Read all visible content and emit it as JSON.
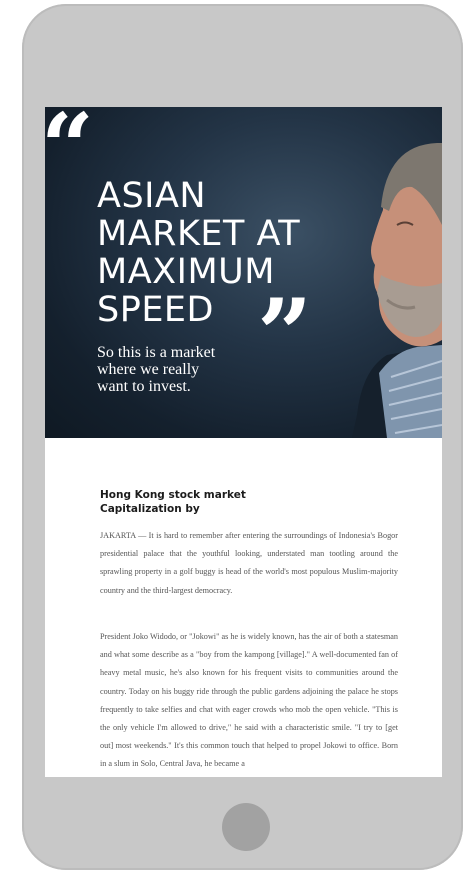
{
  "hero": {
    "headline_lines": [
      "ASIAN",
      "MARKET AT",
      "MAXIMUM",
      "SPEED"
    ],
    "subline_lines": [
      "So this is a market",
      "where we really",
      "want to invest."
    ],
    "open_quote": "“",
    "close_quote": "”"
  },
  "article": {
    "title_lines": [
      "Hong Kong stock market",
      "Capitalization by"
    ],
    "paragraph1": "JAKARTA — It is hard to remember after entering the surroundings of Indonesia's Bogor presidential palace that the youthful looking, understated man tootling around the sprawling property in a golf buggy is head of the world's most populous Muslim-majority country and the third-largest democracy.",
    "paragraph2": "President Joko Widodo, or \"Jokowi\" as he is widely known, has the air of both a statesman and what some describe as a \"boy from the kampong [village].\" A well-documented fan of heavy metal music, he's also known for his frequent visits to communities around the country. Today on his buggy ride through the public gardens adjoining the palace he stops frequently to take selfies and chat with eager crowds who mob the open vehicle. \"This is the only vehicle I'm allowed to drive,\" he said with a characteristic smile. \"I try to [get out] most weekends.\" It's this common touch that helped to propel Jokowi to office. Born in a slum in Solo, Central Java, he became a"
  },
  "colors": {
    "phone_body": "#c8c8c8",
    "home_button": "#a2a2a2",
    "hero_background": "#1a2633"
  }
}
